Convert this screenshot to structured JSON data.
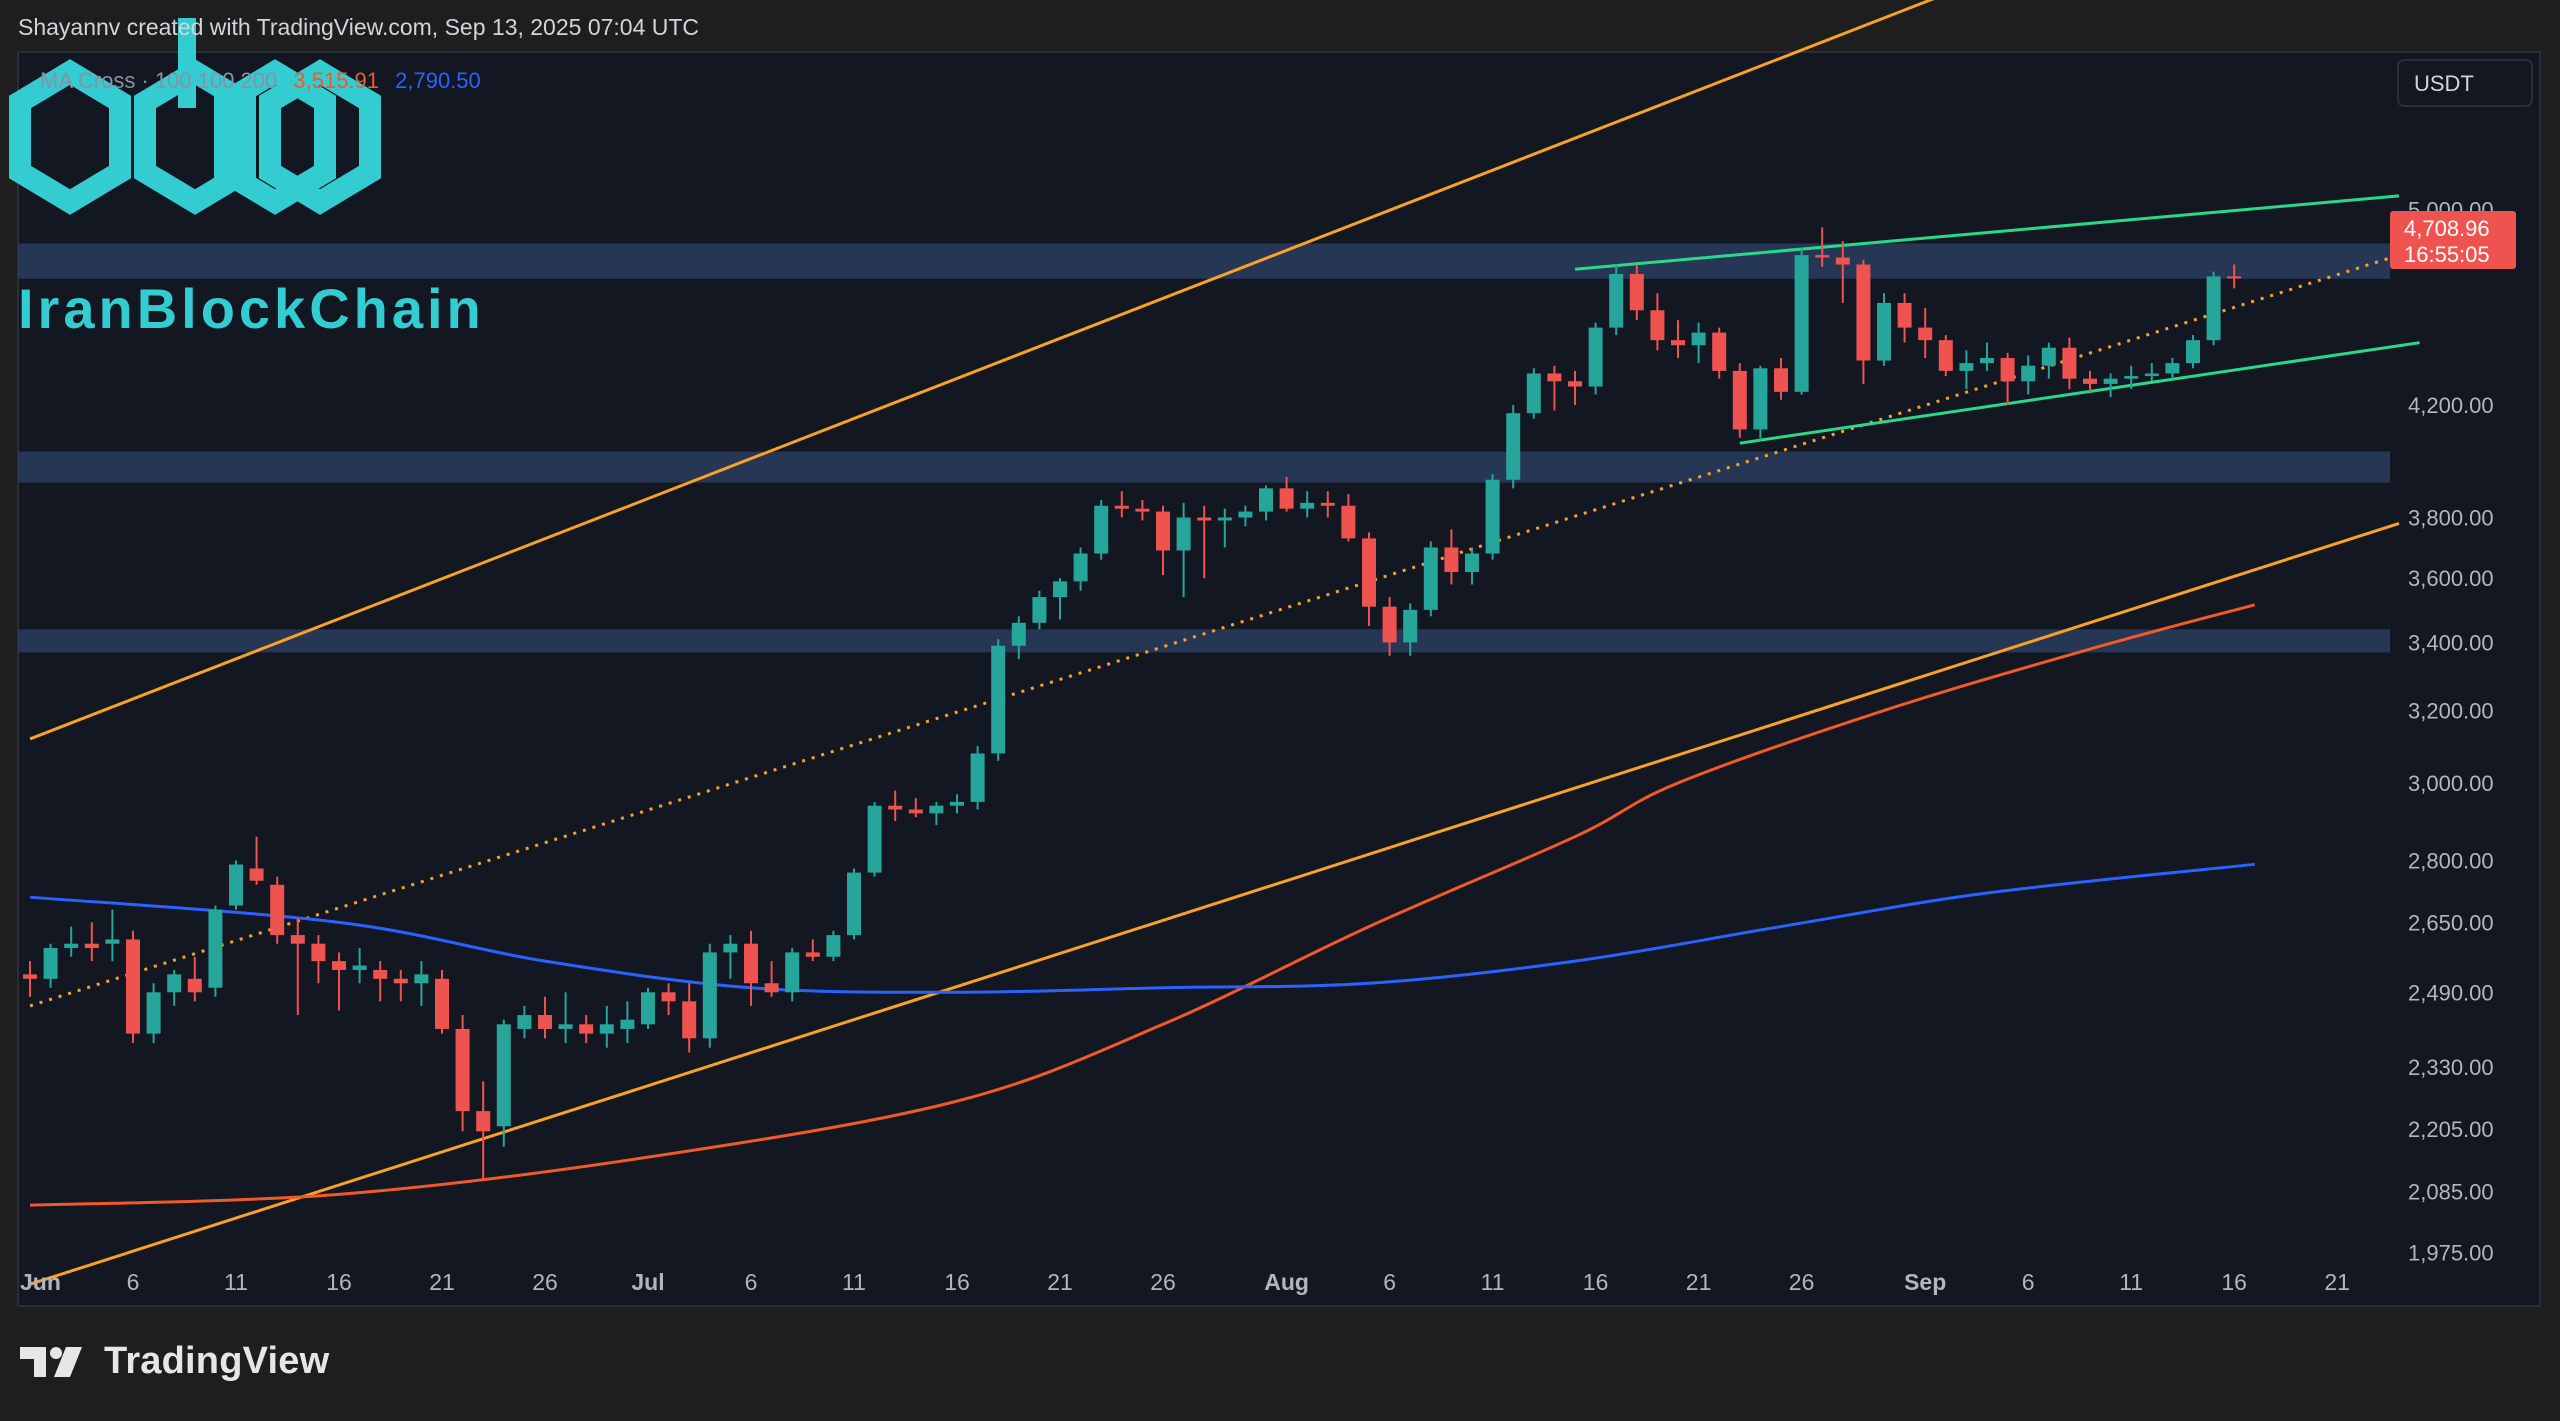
{
  "header": {
    "text": "Shayannv created with TradingView.com, Sep 13, 2025 07:04 UTC"
  },
  "legend": {
    "label": "MA Cross · 100 100 200",
    "ma1_value": "3,515.91",
    "ma2_value": "2,790.50"
  },
  "currency": "USDT",
  "watermark": {
    "text": "IranBlockChain"
  },
  "footer": {
    "brand": "TradingView"
  },
  "price_label": {
    "price": "4,708.96",
    "countdown": "16:55:05"
  },
  "colors": {
    "bg": "#131722",
    "up": "#26a69a",
    "down": "#ef5350",
    "zone": "#2a3c5e",
    "orange": "#f7a226",
    "green": "#29d98a",
    "ma_red": "#f05a28",
    "ma_blue": "#2962ff",
    "watermark": "#35d6da"
  },
  "chart_data": {
    "type": "candlestick",
    "title": "",
    "x_axis_labels": [
      "Jun",
      "6",
      "11",
      "16",
      "21",
      "26",
      "Jul",
      "6",
      "11",
      "16",
      "21",
      "26",
      "Aug",
      "6",
      "11",
      "16",
      "21",
      "26",
      "Sep",
      "6",
      "11",
      "16",
      "21"
    ],
    "y_axis_labels": [
      "5,000.00",
      "4,200.00",
      "3,800.00",
      "3,600.00",
      "3,400.00",
      "3,200.00",
      "3,000.00",
      "2,800.00",
      "2,650.00",
      "2,490.00",
      "2,330.00",
      "2,205.00",
      "2,085.00",
      "1,975.00"
    ],
    "y_scale": "log",
    "ylim": [
      1900,
      5600
    ],
    "start_date": "2025-06-01",
    "candles": [
      {
        "o": 2530,
        "h": 2560,
        "l": 2480,
        "c": 2520
      },
      {
        "o": 2520,
        "h": 2600,
        "l": 2500,
        "c": 2590
      },
      {
        "o": 2590,
        "h": 2640,
        "l": 2570,
        "c": 2600
      },
      {
        "o": 2600,
        "h": 2650,
        "l": 2560,
        "c": 2590
      },
      {
        "o": 2600,
        "h": 2680,
        "l": 2560,
        "c": 2610
      },
      {
        "o": 2610,
        "h": 2630,
        "l": 2380,
        "c": 2400
      },
      {
        "o": 2400,
        "h": 2510,
        "l": 2380,
        "c": 2490
      },
      {
        "o": 2490,
        "h": 2540,
        "l": 2460,
        "c": 2530
      },
      {
        "o": 2520,
        "h": 2570,
        "l": 2470,
        "c": 2490
      },
      {
        "o": 2500,
        "h": 2690,
        "l": 2480,
        "c": 2680
      },
      {
        "o": 2690,
        "h": 2800,
        "l": 2680,
        "c": 2790
      },
      {
        "o": 2780,
        "h": 2860,
        "l": 2740,
        "c": 2750
      },
      {
        "o": 2740,
        "h": 2760,
        "l": 2600,
        "c": 2620
      },
      {
        "o": 2620,
        "h": 2660,
        "l": 2440,
        "c": 2600
      },
      {
        "o": 2600,
        "h": 2620,
        "l": 2510,
        "c": 2560
      },
      {
        "o": 2560,
        "h": 2580,
        "l": 2450,
        "c": 2540
      },
      {
        "o": 2540,
        "h": 2590,
        "l": 2510,
        "c": 2550
      },
      {
        "o": 2540,
        "h": 2560,
        "l": 2470,
        "c": 2520
      },
      {
        "o": 2520,
        "h": 2540,
        "l": 2470,
        "c": 2510
      },
      {
        "o": 2510,
        "h": 2560,
        "l": 2460,
        "c": 2530
      },
      {
        "o": 2520,
        "h": 2540,
        "l": 2400,
        "c": 2410
      },
      {
        "o": 2410,
        "h": 2440,
        "l": 2200,
        "c": 2240
      },
      {
        "o": 2240,
        "h": 2300,
        "l": 2110,
        "c": 2200
      },
      {
        "o": 2210,
        "h": 2430,
        "l": 2170,
        "c": 2420
      },
      {
        "o": 2410,
        "h": 2460,
        "l": 2390,
        "c": 2440
      },
      {
        "o": 2440,
        "h": 2480,
        "l": 2390,
        "c": 2410
      },
      {
        "o": 2410,
        "h": 2490,
        "l": 2380,
        "c": 2420
      },
      {
        "o": 2420,
        "h": 2440,
        "l": 2380,
        "c": 2400
      },
      {
        "o": 2400,
        "h": 2460,
        "l": 2370,
        "c": 2420
      },
      {
        "o": 2410,
        "h": 2470,
        "l": 2380,
        "c": 2430
      },
      {
        "o": 2420,
        "h": 2500,
        "l": 2410,
        "c": 2490
      },
      {
        "o": 2490,
        "h": 2510,
        "l": 2440,
        "c": 2470
      },
      {
        "o": 2470,
        "h": 2510,
        "l": 2360,
        "c": 2390
      },
      {
        "o": 2390,
        "h": 2600,
        "l": 2370,
        "c": 2580
      },
      {
        "o": 2580,
        "h": 2620,
        "l": 2520,
        "c": 2600
      },
      {
        "o": 2600,
        "h": 2630,
        "l": 2460,
        "c": 2510
      },
      {
        "o": 2510,
        "h": 2560,
        "l": 2480,
        "c": 2490
      },
      {
        "o": 2490,
        "h": 2590,
        "l": 2470,
        "c": 2580
      },
      {
        "o": 2580,
        "h": 2610,
        "l": 2560,
        "c": 2570
      },
      {
        "o": 2570,
        "h": 2630,
        "l": 2560,
        "c": 2620
      },
      {
        "o": 2620,
        "h": 2780,
        "l": 2610,
        "c": 2770
      },
      {
        "o": 2770,
        "h": 2950,
        "l": 2760,
        "c": 2940
      },
      {
        "o": 2940,
        "h": 2980,
        "l": 2900,
        "c": 2930
      },
      {
        "o": 2930,
        "h": 2960,
        "l": 2910,
        "c": 2920
      },
      {
        "o": 2920,
        "h": 2950,
        "l": 2890,
        "c": 2940
      },
      {
        "o": 2940,
        "h": 2970,
        "l": 2920,
        "c": 2950
      },
      {
        "o": 2950,
        "h": 3100,
        "l": 2930,
        "c": 3080
      },
      {
        "o": 3080,
        "h": 3410,
        "l": 3060,
        "c": 3390
      },
      {
        "o": 3390,
        "h": 3480,
        "l": 3350,
        "c": 3460
      },
      {
        "o": 3460,
        "h": 3560,
        "l": 3440,
        "c": 3540
      },
      {
        "o": 3540,
        "h": 3600,
        "l": 3470,
        "c": 3590
      },
      {
        "o": 3590,
        "h": 3700,
        "l": 3560,
        "c": 3680
      },
      {
        "o": 3680,
        "h": 3860,
        "l": 3660,
        "c": 3840
      },
      {
        "o": 3840,
        "h": 3890,
        "l": 3800,
        "c": 3830
      },
      {
        "o": 3830,
        "h": 3860,
        "l": 3790,
        "c": 3820
      },
      {
        "o": 3820,
        "h": 3840,
        "l": 3610,
        "c": 3690
      },
      {
        "o": 3690,
        "h": 3850,
        "l": 3540,
        "c": 3800
      },
      {
        "o": 3800,
        "h": 3840,
        "l": 3600,
        "c": 3790
      },
      {
        "o": 3790,
        "h": 3830,
        "l": 3700,
        "c": 3800
      },
      {
        "o": 3800,
        "h": 3840,
        "l": 3770,
        "c": 3820
      },
      {
        "o": 3820,
        "h": 3910,
        "l": 3790,
        "c": 3900
      },
      {
        "o": 3900,
        "h": 3940,
        "l": 3820,
        "c": 3830
      },
      {
        "o": 3830,
        "h": 3890,
        "l": 3800,
        "c": 3850
      },
      {
        "o": 3850,
        "h": 3890,
        "l": 3800,
        "c": 3840
      },
      {
        "o": 3840,
        "h": 3880,
        "l": 3720,
        "c": 3730
      },
      {
        "o": 3730,
        "h": 3750,
        "l": 3450,
        "c": 3510
      },
      {
        "o": 3510,
        "h": 3540,
        "l": 3360,
        "c": 3400
      },
      {
        "o": 3400,
        "h": 3520,
        "l": 3360,
        "c": 3500
      },
      {
        "o": 3500,
        "h": 3720,
        "l": 3480,
        "c": 3700
      },
      {
        "o": 3700,
        "h": 3760,
        "l": 3580,
        "c": 3620
      },
      {
        "o": 3620,
        "h": 3700,
        "l": 3580,
        "c": 3680
      },
      {
        "o": 3680,
        "h": 3950,
        "l": 3660,
        "c": 3930
      },
      {
        "o": 3930,
        "h": 4200,
        "l": 3900,
        "c": 4170
      },
      {
        "o": 4170,
        "h": 4340,
        "l": 4150,
        "c": 4320
      },
      {
        "o": 4320,
        "h": 4350,
        "l": 4180,
        "c": 4290
      },
      {
        "o": 4290,
        "h": 4330,
        "l": 4200,
        "c": 4270
      },
      {
        "o": 4270,
        "h": 4520,
        "l": 4240,
        "c": 4500
      },
      {
        "o": 4500,
        "h": 4760,
        "l": 4470,
        "c": 4720
      },
      {
        "o": 4720,
        "h": 4760,
        "l": 4530,
        "c": 4570
      },
      {
        "o": 4570,
        "h": 4640,
        "l": 4410,
        "c": 4450
      },
      {
        "o": 4450,
        "h": 4530,
        "l": 4380,
        "c": 4430
      },
      {
        "o": 4430,
        "h": 4520,
        "l": 4360,
        "c": 4480
      },
      {
        "o": 4480,
        "h": 4500,
        "l": 4300,
        "c": 4330
      },
      {
        "o": 4330,
        "h": 4360,
        "l": 4080,
        "c": 4110
      },
      {
        "o": 4110,
        "h": 4350,
        "l": 4070,
        "c": 4340
      },
      {
        "o": 4340,
        "h": 4380,
        "l": 4220,
        "c": 4250
      },
      {
        "o": 4250,
        "h": 4830,
        "l": 4240,
        "c": 4800
      },
      {
        "o": 4800,
        "h": 4920,
        "l": 4750,
        "c": 4790
      },
      {
        "o": 4790,
        "h": 4860,
        "l": 4600,
        "c": 4760
      },
      {
        "o": 4760,
        "h": 4780,
        "l": 4280,
        "c": 4370
      },
      {
        "o": 4370,
        "h": 4640,
        "l": 4350,
        "c": 4600
      },
      {
        "o": 4600,
        "h": 4640,
        "l": 4440,
        "c": 4500
      },
      {
        "o": 4500,
        "h": 4580,
        "l": 4380,
        "c": 4450
      },
      {
        "o": 4450,
        "h": 4470,
        "l": 4310,
        "c": 4330
      },
      {
        "o": 4330,
        "h": 4410,
        "l": 4260,
        "c": 4360
      },
      {
        "o": 4360,
        "h": 4440,
        "l": 4330,
        "c": 4380
      },
      {
        "o": 4380,
        "h": 4400,
        "l": 4200,
        "c": 4290
      },
      {
        "o": 4290,
        "h": 4390,
        "l": 4240,
        "c": 4350
      },
      {
        "o": 4350,
        "h": 4440,
        "l": 4300,
        "c": 4420
      },
      {
        "o": 4420,
        "h": 4460,
        "l": 4260,
        "c": 4300
      },
      {
        "o": 4300,
        "h": 4330,
        "l": 4250,
        "c": 4280
      },
      {
        "o": 4280,
        "h": 4320,
        "l": 4230,
        "c": 4300
      },
      {
        "o": 4300,
        "h": 4350,
        "l": 4260,
        "c": 4310
      },
      {
        "o": 4310,
        "h": 4360,
        "l": 4290,
        "c": 4320
      },
      {
        "o": 4320,
        "h": 4380,
        "l": 4300,
        "c": 4360
      },
      {
        "o": 4360,
        "h": 4470,
        "l": 4340,
        "c": 4450
      },
      {
        "o": 4450,
        "h": 4730,
        "l": 4430,
        "c": 4710
      },
      {
        "o": 4710,
        "h": 4760,
        "l": 4660,
        "c": 4709
      }
    ],
    "ma_red": [
      [
        0,
        2060
      ],
      [
        15,
        2080
      ],
      [
        30,
        2150
      ],
      [
        45,
        2260
      ],
      [
        55,
        2420
      ],
      [
        65,
        2640
      ],
      [
        75,
        2860
      ],
      [
        80,
        3000
      ],
      [
        90,
        3200
      ],
      [
        100,
        3380
      ],
      [
        108,
        3515.91
      ]
    ],
    "ma_blue": [
      [
        0,
        2710
      ],
      [
        15,
        2650
      ],
      [
        25,
        2560
      ],
      [
        35,
        2500
      ],
      [
        45,
        2490
      ],
      [
        55,
        2500
      ],
      [
        65,
        2510
      ],
      [
        75,
        2560
      ],
      [
        85,
        2640
      ],
      [
        95,
        2720
      ],
      [
        108,
        2790.5
      ]
    ],
    "zones": [
      [
        4700,
        4850
      ],
      [
        3920,
        4030
      ],
      [
        3370,
        3440
      ]
    ],
    "orange_channel_upper": [
      [
        0,
        3120
      ],
      [
        94,
        6100
      ]
    ],
    "orange_channel_lower": [
      [
        0,
        1920
      ],
      [
        115,
        3780
      ]
    ],
    "orange_midline": [
      [
        0,
        2460
      ],
      [
        115,
        4800
      ]
    ],
    "green_upper": [
      [
        75,
        4740
      ],
      [
        115,
        5060
      ]
    ],
    "green_lower": [
      [
        83,
        4060
      ],
      [
        116,
        4440
      ]
    ]
  }
}
